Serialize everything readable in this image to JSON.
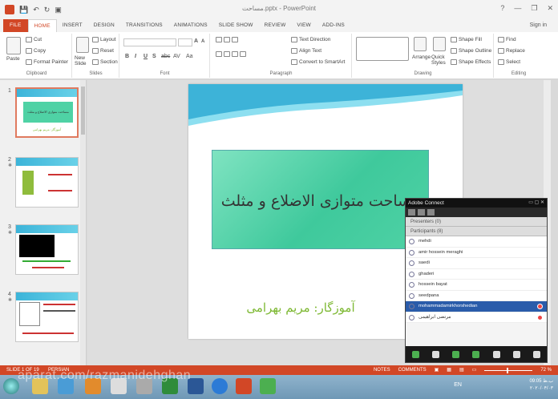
{
  "titlebar": {
    "doc_title": "مساحت.pptx - PowerPoint",
    "qat_save": "💾",
    "qat_undo": "↶",
    "qat_redo": "↻",
    "qat_start": "▣",
    "help": "?",
    "minimize": "—",
    "restore": "❐",
    "close": "✕"
  },
  "tabs": [
    "FILE",
    "HOME",
    "INSERT",
    "DESIGN",
    "TRANSITIONS",
    "ANIMATIONS",
    "SLIDE SHOW",
    "REVIEW",
    "VIEW",
    "ADD-INS"
  ],
  "signin": "Sign in",
  "ribbon": {
    "clipboard": {
      "label": "Clipboard",
      "paste": "Paste",
      "cut": "Cut",
      "copy": "Copy",
      "format_painter": "Format Painter"
    },
    "slides": {
      "label": "Slides",
      "new_slide": "New Slide",
      "layout": "Layout",
      "reset": "Reset",
      "section": "Section"
    },
    "font": {
      "label": "Font",
      "bold": "B",
      "italic": "I",
      "underline": "U",
      "shadow": "S",
      "strike": "abc",
      "spacing": "AV",
      "case": "Aa",
      "grow": "A",
      "shrink": "A"
    },
    "paragraph": {
      "label": "Paragraph",
      "text_direction": "Text Direction",
      "align_text": "Align Text",
      "smartart": "Convert to SmartArt"
    },
    "drawing": {
      "label": "Drawing",
      "arrange": "Arrange",
      "quick_styles": "Quick Styles",
      "shape_fill": "Shape Fill",
      "shape_outline": "Shape Outline",
      "shape_effects": "Shape Effects"
    },
    "editing": {
      "label": "Editing",
      "find": "Find",
      "replace": "Replace",
      "select": "Select"
    }
  },
  "thumbnails": [
    {
      "num": "1",
      "title": "مساحت متوازی الاضلاع و مثلث",
      "subtitle": "آموزگار: مریم بهرامی"
    },
    {
      "num": "2"
    },
    {
      "num": "3"
    },
    {
      "num": "4"
    }
  ],
  "slide": {
    "title": "مساحت متوازی الاضلاع و مثلث",
    "subtitle": "آموزگار: مریم بهرامی"
  },
  "adobe_connect": {
    "title": "Adobe Connect",
    "presenters": "Presenters (0)",
    "participants": "Participants (8)",
    "users": [
      {
        "name": "mehdi",
        "selected": false
      },
      {
        "name": "amir hossein meraghi",
        "selected": false
      },
      {
        "name": "saedi",
        "selected": false
      },
      {
        "name": "ghaderi",
        "selected": false
      },
      {
        "name": "hossein bayat",
        "selected": false
      },
      {
        "name": "seedpana",
        "selected": false
      },
      {
        "name": "mohammadamirkhorshedian",
        "selected": true
      },
      {
        "name": "مرتضی ابراهیمی",
        "selected": false
      }
    ]
  },
  "statusbar": {
    "slide_of": "SLIDE 1 OF 19",
    "language": "PERSIAN",
    "notes": "NOTES",
    "comments": "COMMENTS",
    "zoom": "72 %"
  },
  "taskbar": {
    "watermark": "aparat.com/razmanidehghan",
    "lang": "EN",
    "time": "09:05 ب.ظ",
    "date": "۲۰۲۰/۰۴/۰۳"
  },
  "colors": {
    "accent": "#d24726",
    "slide_box": "#4fd2a5",
    "subtitle": "#7db832",
    "ac_selected": "#2a5caa"
  }
}
